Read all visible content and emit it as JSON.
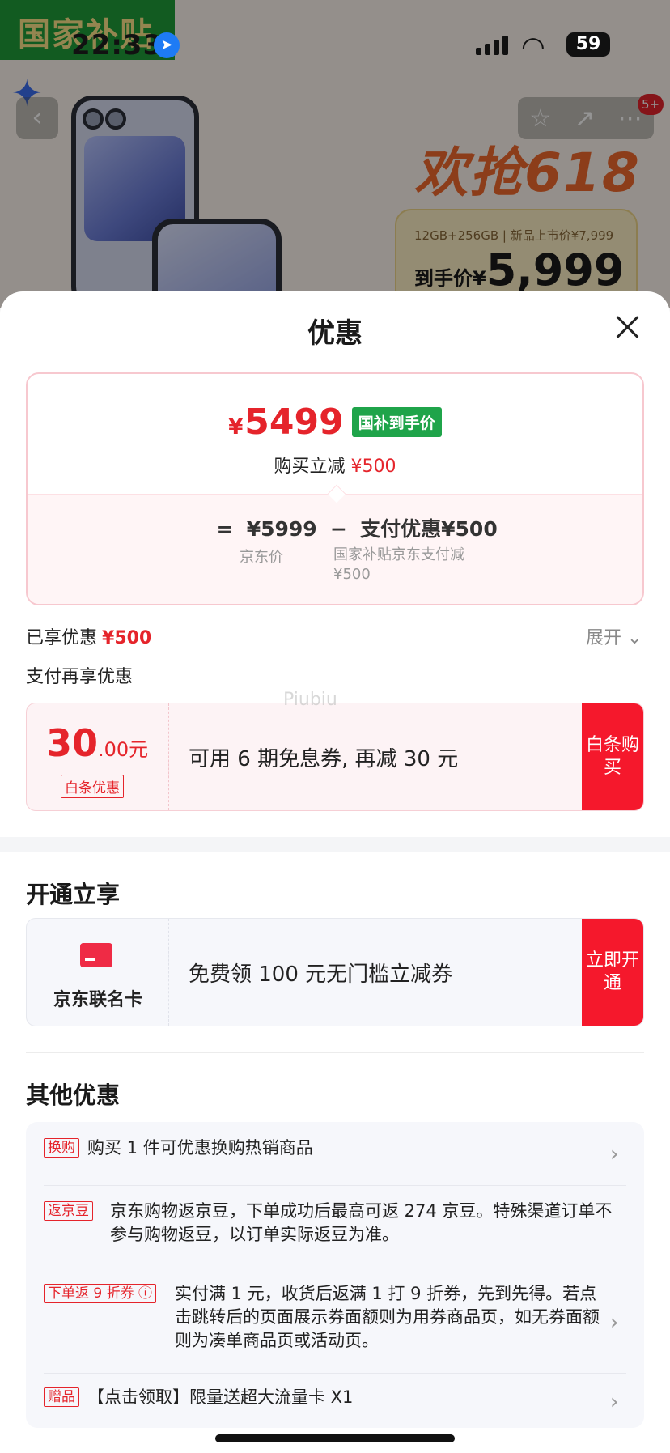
{
  "status_bar": {
    "time": "22:33",
    "battery": "59"
  },
  "background": {
    "subsidy_badge": "国家补贴",
    "promo_title": "欢抢618",
    "spec": "12GB+256GB | 新品上市价",
    "list_price": "¥7,999",
    "final_label": "到手价¥",
    "final_price": "5,999",
    "notification_badge": "5+"
  },
  "sheet": {
    "title": "优惠"
  },
  "price_summary": {
    "currency": "¥",
    "amount": "5499",
    "tag": "国补到手价",
    "reduce_label": "购买立减",
    "reduce_amount": "¥500",
    "formula_price": "¥5999",
    "formula_discount": "支付优惠¥500",
    "note_price": "京东价",
    "note_discount": "国家补贴京东支付减¥500"
  },
  "enjoyed": {
    "label": "已享优惠",
    "amount": "¥500",
    "expand": "展开"
  },
  "pay_more": {
    "label": "支付再享优惠"
  },
  "baitiao": {
    "amount_big": "30",
    "amount_small": ".00元",
    "label": "白条优惠",
    "description": "可用 6 期免息券, 再减 30 元",
    "action": "白条购买"
  },
  "watermark": "Piubiu",
  "open_section": {
    "title": "开通立享",
    "card_name": "京东联名卡",
    "description": "免费领 100 元无门槛立减券",
    "action": "立即开通"
  },
  "other_section": {
    "title": "其他优惠",
    "items": [
      {
        "tag": "换购",
        "text": "购买 1 件可优惠换购热销商品"
      },
      {
        "tag": "返京豆",
        "text": "京东购物返京豆，下单成功后最高可返 274 京豆。特殊渠道订单不参与购物返豆，以订单实际返豆为准。"
      },
      {
        "tag": "下单返 9 折券",
        "text": "实付满 1 元，收货后返满 1 打 9 折券，先到先得。若点击跳转后的页面展示券面额则为用券商品页，如无券面额则为凑单商品页或活动页。"
      },
      {
        "tag": "赠品",
        "text": "【点击领取】限量送超大流量卡 X1"
      }
    ]
  }
}
